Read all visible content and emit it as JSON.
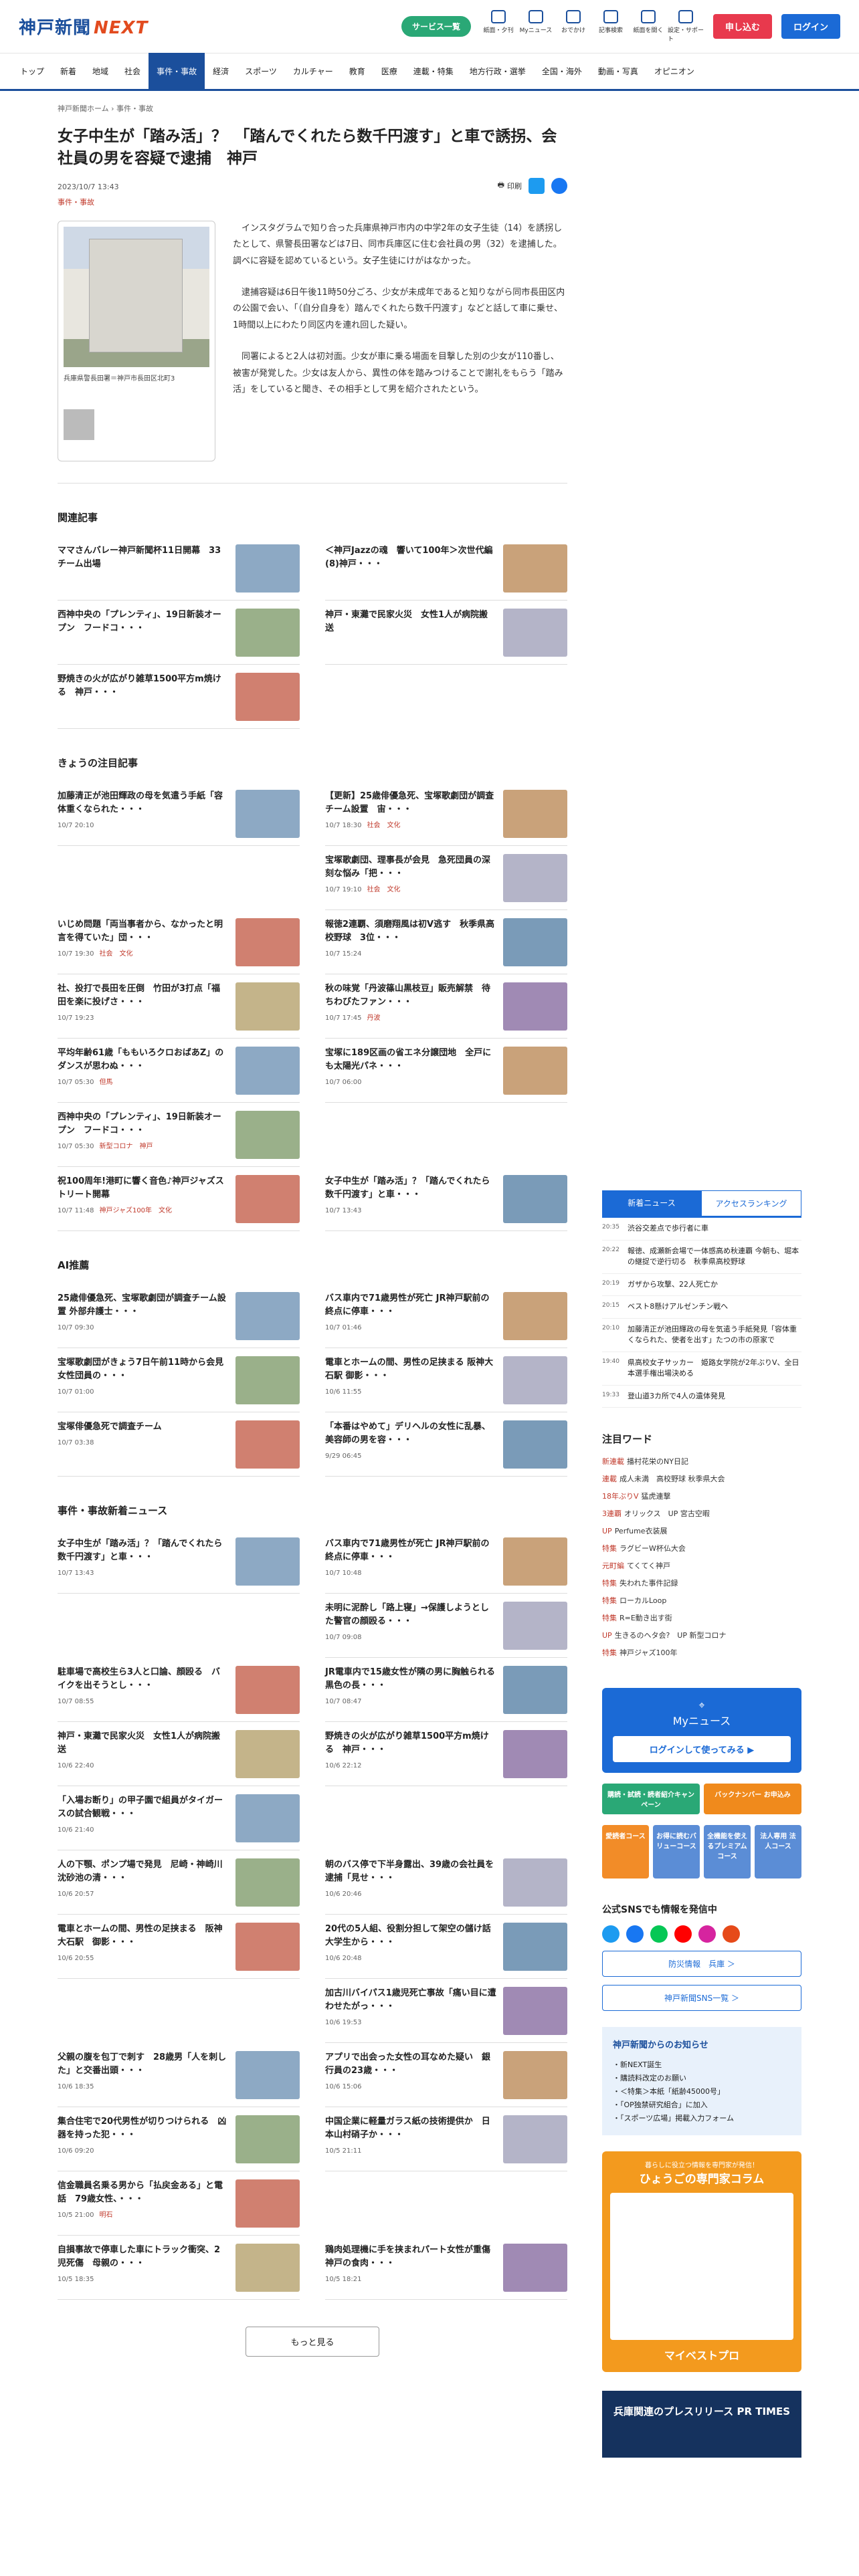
{
  "header": {
    "logo": "神戸新聞",
    "logo_next": "NEXT",
    "service_btn": "サービス一覧",
    "icons": [
      "紙面・夕刊",
      "Myニュース",
      "おでかけ",
      "記事検索",
      "紙面を開く",
      "設定・サポート"
    ],
    "subscribe": "申し込む",
    "login": "ログイン"
  },
  "nav": [
    "トップ",
    "新着",
    "地域",
    "社会",
    "事件・事故",
    "経済",
    "スポーツ",
    "カルチャー",
    "教育",
    "医療",
    "連載・特集",
    "地方行政・選挙",
    "全国・海外",
    "動画・写真",
    "オピニオン"
  ],
  "breadcrumb": "神戸新聞ホーム › 事件・事故",
  "article": {
    "title": "女子中生が「踏み活」？　「踏んでくれたら数千円渡す」と車で誘拐、会社員の男を容疑で逮捕　神戸",
    "date": "2023/10/7 13:43",
    "category": "事件・事故",
    "print": "印刷",
    "photo_caption": "兵庫県警長田署＝神戸市長田区北町3",
    "paragraphs": [
      "インスタグラムで知り合った兵庫県神戸市内の中学2年の女子生徒（14）を誘拐したとして、県警長田署などは7日、同市兵庫区に住む会社員の男（32）を逮捕した。調べに容疑を認めているという。女子生徒にけがはなかった。",
      "逮捕容疑は6日午後11時50分ごろ、少女が未成年であると知りながら同市長田区内の公園で会い、「（自分自身を）踏んでくれたら数千円渡す」などと話して車に乗せ、1時間以上にわたり同区内を連れ回した疑い。",
      "同署によると2人は初対面。少女が車に乗る場面を目撃した別の少女が110番し、被害が発覚した。少女は友人から、異性の体を踏みつけることで謝礼をもらう「踏み活」をしていると聞き、その相手として男を紹介されたという。"
    ]
  },
  "related": {
    "heading": "関連記事",
    "items": [
      {
        "title": "ママさんバレー神戸新聞杯11日開幕　33チーム出場",
        "meta": "",
        "tag": ""
      },
      {
        "title": "＜神戸Jazzの魂　響いて100年＞次世代編(8)神戸・・・",
        "meta": "",
        "tag": ""
      },
      {
        "title": "西神中央の「プレンティ」、19日新装オープン　フードコ・・・",
        "meta": "",
        "tag": ""
      },
      {
        "title": "神戸・東灘で民家火災　女性1人が病院搬送",
        "meta": "",
        "tag": ""
      },
      {
        "title": "野焼きの火が広がり雑草1500平方m焼ける　神戸・・・",
        "meta": "",
        "tag": ""
      }
    ]
  },
  "featured": {
    "heading": "きょうの注目記事",
    "items": [
      {
        "title": "加藤清正が池田輝政の母を気遣う手紙「容体重くなられた・・・",
        "meta": "10/7 20:10",
        "tag": ""
      },
      {
        "title": "【更新】25歳俳優急死、宝塚歌劇団が調査チーム設置　宙・・・",
        "meta": "10/7 18:30",
        "tag": "社会　文化"
      },
      {
        "title": "",
        "meta": "",
        "tag": ""
      },
      {
        "title": "宝塚歌劇団、理事長が会見　急死団員の深刻な悩み「把・・・",
        "meta": "10/7 19:10",
        "tag": "社会　文化"
      },
      {
        "title": "いじめ問題「両当事者から、なかったと明言を得ていた」団・・・",
        "meta": "10/7 19:30",
        "tag": "社会　文化"
      },
      {
        "title": "報徳2連覇、須磨翔風は初V逃す　秋季県高校野球　3位・・・",
        "meta": "10/7 15:24",
        "tag": ""
      },
      {
        "title": "社、投打で長田を圧倒　竹田が3打点「福田を楽に投げさ・・・",
        "meta": "10/7 19:23",
        "tag": ""
      },
      {
        "title": "秋の味覚「丹波篠山黒枝豆」販売解禁　待ちわびたファン・・・",
        "meta": "10/7 17:45",
        "tag": "丹波"
      },
      {
        "title": "平均年齢61歳「ももいろクロおばあZ」のダンスが思わぬ・・・",
        "meta": "10/7 05:30",
        "tag": "但馬"
      },
      {
        "title": "宝塚に189区画の省エネ分譲団地　全戸にも太陽光パネ・・・",
        "meta": "10/7 06:00",
        "tag": ""
      },
      {
        "title": "西神中央の「プレンティ」、19日新装オープン　フードコ・・・",
        "meta": "10/7 05:30",
        "tag": "新型コロナ　神戸"
      },
      {
        "title": "",
        "meta": "",
        "tag": ""
      },
      {
        "title": "祝100周年!港町に響く音色♪神戸ジャズストリート開幕",
        "meta": "10/7 11:48",
        "tag": "神戸ジャズ100年　文化"
      },
      {
        "title": "女子中生が「踏み活」？「踏んでくれたら数千円渡す」と車・・・",
        "meta": "10/7 13:43",
        "tag": ""
      }
    ]
  },
  "ai": {
    "heading": "AI推薦",
    "items": [
      {
        "title": "25歳俳優急死、宝塚歌劇団が調査チーム設置 外部弁護士・・・",
        "meta": "10/7 09:30",
        "tag": ""
      },
      {
        "title": "バス車内で71歳男性が死亡 JR神戸駅前の終点に停車・・・",
        "meta": "10/7 01:46",
        "tag": ""
      },
      {
        "title": "宝塚歌劇団がきょう7日午前11時から会見 女性団員の・・・",
        "meta": "10/7 01:00",
        "tag": ""
      },
      {
        "title": "電車とホームの間、男性の足挟まる 阪神大石駅 御影・・・",
        "meta": "10/6 11:55",
        "tag": ""
      },
      {
        "title": "宝塚俳優急死で調査チーム",
        "meta": "10/7 03:38",
        "tag": ""
      },
      {
        "title": "「本番はやめて」デリヘルの女性に乱暴、美容師の男を容・・・",
        "meta": "9/29 06:45",
        "tag": ""
      }
    ]
  },
  "latest": {
    "heading": "事件・事故新着ニュース",
    "items": [
      {
        "title": "女子中生が「踏み活」？「踏んでくれたら数千円渡す」と車・・・",
        "meta": "10/7 13:43",
        "tag": ""
      },
      {
        "title": "バス車内で71歳男性が死亡 JR神戸駅前の終点に停車・・・",
        "meta": "10/7 10:48",
        "tag": ""
      },
      {
        "title": "",
        "meta": "",
        "tag": ""
      },
      {
        "title": "未明に泥酔し「路上寝」→保護しようとした警官の顔殴る・・・",
        "meta": "10/7 09:08",
        "tag": ""
      },
      {
        "title": "駐車場で高校生ら3人と口論、顔殴る　バイクを出そうとし・・・",
        "meta": "10/7 08:55",
        "tag": ""
      },
      {
        "title": "JR電車内で15歳女性が隣の男に胸触られる　黒色の長・・・",
        "meta": "10/7 08:47",
        "tag": ""
      },
      {
        "title": "神戸・東灘で民家火災　女性1人が病院搬送",
        "meta": "10/6 22:40",
        "tag": ""
      },
      {
        "title": "野焼きの火が広がり雑草1500平方m焼ける　神戸・・・",
        "meta": "10/6 22:12",
        "tag": ""
      },
      {
        "title": "「入場お断り」の甲子園で組員がタイガースの試合観戦・・・",
        "meta": "10/6 21:40",
        "tag": ""
      },
      {
        "title": "",
        "meta": "",
        "tag": ""
      },
      {
        "title": "人の下顎、ポンプ場で発見　尼崎・神崎川　沈砂池の清・・・",
        "meta": "10/6 20:57",
        "tag": ""
      },
      {
        "title": "朝のバス停で下半身露出、39歳の会社員を逮捕「見せ・・・",
        "meta": "10/6 20:46",
        "tag": ""
      },
      {
        "title": "電車とホームの間、男性の足挟まる　阪神大石駅　御影・・・",
        "meta": "10/6 20:55",
        "tag": ""
      },
      {
        "title": "20代の5人組、役割分担して架空の儲け話　大学生から・・・",
        "meta": "10/6 20:48",
        "tag": ""
      },
      {
        "title": "",
        "meta": "",
        "tag": ""
      },
      {
        "title": "加古川バイパス1歳児死亡事故「痛い目に遭わせたがっ・・・",
        "meta": "10/6 19:53",
        "tag": ""
      },
      {
        "title": "父親の腹を包丁で刺す　28歳男「人を刺した」と交番出頭・・・",
        "meta": "10/6 18:35",
        "tag": ""
      },
      {
        "title": "アプリで出会った女性の耳なめた疑い　銀行員の23歳・・・",
        "meta": "10/6 15:06",
        "tag": ""
      },
      {
        "title": "集合住宅で20代男性が切りつけられる　凶器を持った犯・・・",
        "meta": "10/6 09:20",
        "tag": ""
      },
      {
        "title": "中国企業に軽量ガラス紙の技術提供か　日本山村硝子か・・・",
        "meta": "10/5 21:11",
        "tag": ""
      },
      {
        "title": "信金職員名乗る男から「払戻金ある」と電話　79歳女性、・・・",
        "meta": "10/5 21:00",
        "tag": "明石"
      },
      {
        "title": "",
        "meta": "",
        "tag": ""
      },
      {
        "title": "自損事故で停車した車にトラック衝突、2児死傷　母親の・・・",
        "meta": "10/5 18:35",
        "tag": ""
      },
      {
        "title": "鶏肉処理機に手を挟まれパート女性が重傷　神戸の食肉・・・",
        "meta": "10/5 18:21",
        "tag": ""
      }
    ]
  },
  "more": "もっと見る",
  "side": {
    "tabs": [
      "新着ニュース",
      "アクセスランキング"
    ],
    "news": [
      {
        "t": "20:35",
        "s": "渋谷交差点で歩行者に車"
      },
      {
        "t": "20:22",
        "s": "報徳、成瀬新会場で一体感高め秋連覇 今朝も、堀本の継捉で逆行切る　秋季県高校野球"
      },
      {
        "t": "20:19",
        "s": "ガザから攻撃、22人死亡か"
      },
      {
        "t": "20:15",
        "s": "ベスト8懸けアルゼンチン戦へ"
      },
      {
        "t": "20:10",
        "s": "加藤清正が池田輝政の母を気遣う手紙発見「容体重くなられた、使者を出す」たつの市の原家で"
      },
      {
        "t": "19:40",
        "s": "県高校女子サッカー　姫路女学院が2年ぶりV、全日本選手権出場決める"
      },
      {
        "t": "19:33",
        "s": "登山道3カ所で4人の遺体発見"
      }
    ],
    "words_h": "注目ワード",
    "words": [
      [
        "新連載",
        "播村花栄のNY日記"
      ],
      [
        "連載",
        "成人未満　高校野球 秋季県大会"
      ],
      [
        "18年ぶりV",
        "猛虎連撃"
      ],
      [
        "3連覇",
        "オリックス　UP 宮古空暇"
      ],
      [
        "UP",
        "Perfume衣装展"
      ],
      [
        "特集",
        "ラグビーW杯仏大会"
      ],
      [
        "元町編",
        "てくてく神戸"
      ],
      [
        "特集",
        "失われた事件記録"
      ],
      [
        "特集",
        "ローカルLoop"
      ],
      [
        "特集",
        "R=E動き出す街"
      ],
      [
        "UP",
        "生きるのヘタ会?　UP 新型コロナ"
      ],
      [
        "特集",
        "神戸ジャズ100年"
      ]
    ],
    "my": "Myニュース",
    "my_btn": "ログインして使ってみる ▶",
    "promo": [
      "購読・試読・読者紹介キャンペーン",
      "バックナンバー お申込み"
    ],
    "promo2": [
      "愛読者コース",
      "お得に読むバリューコース",
      "全機能を使えるプレミアムコース",
      "法人専用 法人コース"
    ],
    "sns_h": "公式SNSでも情報を発信中",
    "sns_btn1": "防災情報　兵庫 ＞",
    "sns_btn2": "神戸新聞SNS一覧 ＞",
    "notice_h": "神戸新聞からのお知らせ",
    "notice": [
      "・新NEXT誕生",
      "・購読料改定のお願い",
      "・＜特集＞本紙「紙齢45000号」",
      "・「OP独禁研究組合」に加入",
      "・「スポーツ広場」掲載入力フォーム"
    ],
    "col_h": "ひょうごの専門家コラム",
    "col_sub": "暮らしに役立つ情報を専門家が発信！",
    "col_foot": "マイベストプロ",
    "prt": "兵庫関連のプレスリリース PR TIMES"
  },
  "colors": {
    "brand": "#1b4f9c",
    "accent": "#e24b1f"
  }
}
